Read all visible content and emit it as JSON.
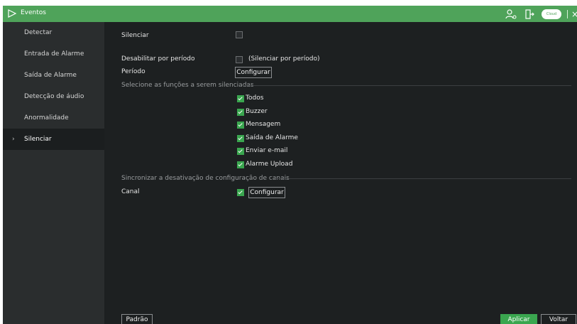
{
  "titlebar": {
    "title": "Eventos",
    "icons": [
      "play-outline-icon",
      "user-settings-icon",
      "logout-icon",
      "cloud-icon",
      "close-icon"
    ],
    "cloud_label": "Cloud",
    "accent": "#4fa35a"
  },
  "sidebar": {
    "items": [
      {
        "label": "Detectar"
      },
      {
        "label": "Entrada de Alarme"
      },
      {
        "label": "Saída de Alarme"
      },
      {
        "label": "Detecção de áudio"
      },
      {
        "label": "Anormalidade"
      },
      {
        "label": "Silenciar",
        "active": true
      }
    ],
    "active_arrow": "›"
  },
  "form": {
    "silenciar_label": "Silenciar",
    "silenciar_checked": false,
    "disable_period_label": "Desabilitar por período",
    "disable_period_checked": false,
    "disable_period_text": "(Silenciar por período)",
    "period_label": "Período",
    "period_button": "Configurar",
    "functions_section": "Selecione as funções a serem silenciadas",
    "functions": [
      {
        "label": "Todos",
        "checked": true
      },
      {
        "label": "Buzzer",
        "checked": true
      },
      {
        "label": "Mensagem",
        "checked": true
      },
      {
        "label": "Saída de Alarme",
        "checked": true
      },
      {
        "label": "Enviar e-mail",
        "checked": true
      },
      {
        "label": "Alarme Upload",
        "checked": true
      }
    ],
    "sync_section": "Sincronizar a desativação de configuração de canais",
    "channel_label": "Canal",
    "channel_checked": true,
    "channel_button": "Configurar"
  },
  "footer": {
    "default_button": "Padrão",
    "apply_button": "Aplicar",
    "back_button": "Voltar"
  },
  "colors": {
    "check_green": "#3aa64f",
    "background": "#1d2021"
  }
}
